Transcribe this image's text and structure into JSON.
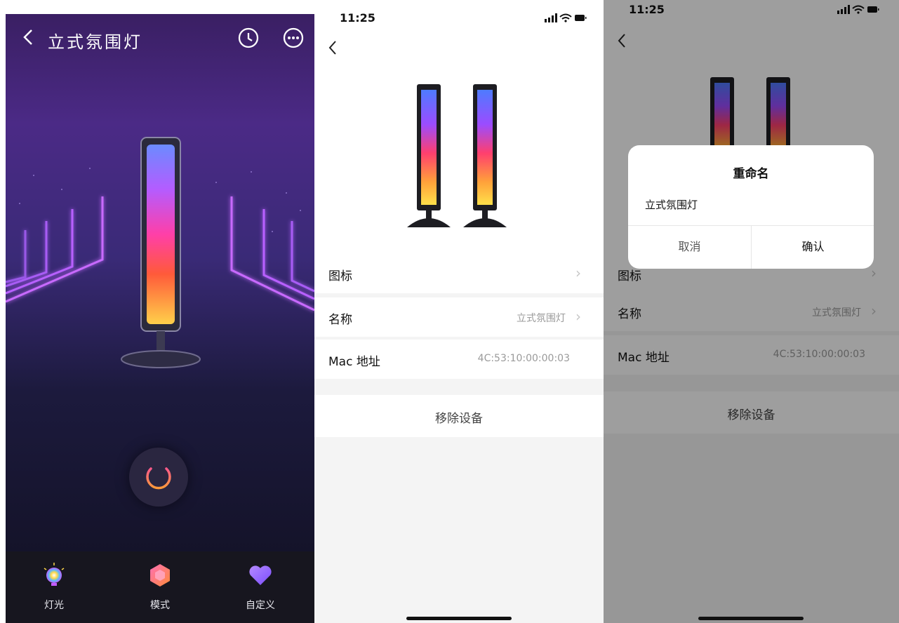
{
  "control": {
    "back_icon": "chevron-left-icon",
    "title": "立式氛围灯",
    "timer_icon": "clock-icon",
    "more_icon": "more-horizontal-icon",
    "power_icon": "power-icon",
    "tabs": [
      {
        "label": "灯光",
        "icon": "color-bulb-icon"
      },
      {
        "label": "模式",
        "icon": "hexagon-mode-icon"
      },
      {
        "label": "自定义",
        "icon": "heart-icon"
      }
    ]
  },
  "settings": {
    "status_time": "11:25",
    "back_icon": "chevron-left-icon",
    "rows": {
      "icon_label": "图标",
      "name_label": "名称",
      "name_value": "立式氛围灯",
      "mac_label": "Mac 地址",
      "mac_value": "4C:53:10:00:00:03"
    },
    "remove_label": "移除设备"
  },
  "rename": {
    "status_time": "11:25",
    "dialog_title": "重命名",
    "input_value": "立式氛围灯",
    "cancel_label": "取消",
    "confirm_label": "确认",
    "bg_rows": {
      "icon_label": "图标",
      "name_label": "名称",
      "name_value": "立式氛围灯",
      "mac_label": "Mac 地址",
      "mac_value": "4C:53:10:00:00:03"
    },
    "remove_label": "移除设备"
  }
}
